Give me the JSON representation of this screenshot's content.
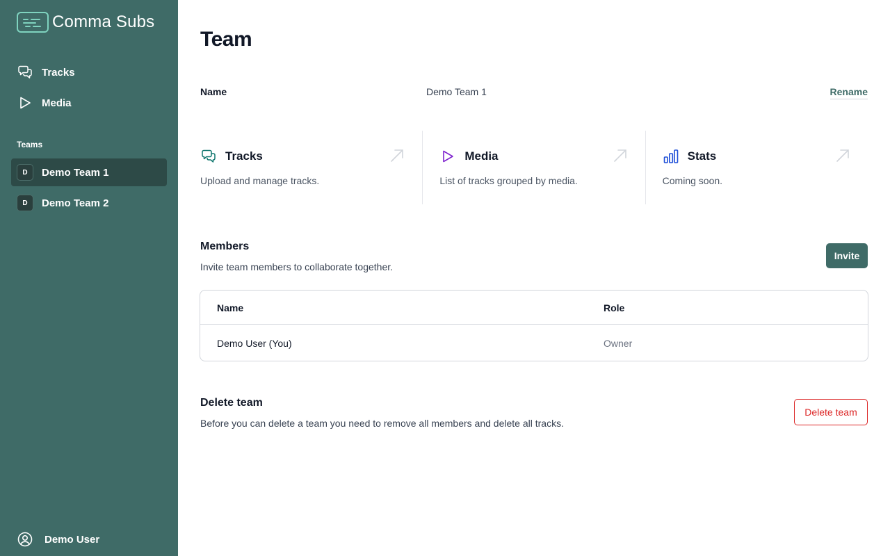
{
  "app": {
    "name": "Comma Subs"
  },
  "sidebar": {
    "nav": [
      {
        "label": "Tracks",
        "icon": "chat-bubbles-icon"
      },
      {
        "label": "Media",
        "icon": "play-icon"
      }
    ],
    "teams_heading": "Teams",
    "teams": [
      {
        "initial": "D",
        "label": "Demo Team 1",
        "active": true
      },
      {
        "initial": "D",
        "label": "Demo Team 2",
        "active": false
      }
    ],
    "user": {
      "label": "Demo User",
      "icon": "user-circle-icon"
    }
  },
  "page": {
    "title": "Team",
    "name_label": "Name",
    "name_value": "Demo Team 1",
    "rename_label": "Rename"
  },
  "cards": [
    {
      "title": "Tracks",
      "description": "Upload and manage tracks.",
      "icon": "chat-bubbles-icon",
      "color": "#0f766e"
    },
    {
      "title": "Media",
      "description": "List of tracks grouped by media.",
      "icon": "play-icon",
      "color": "#7e22ce"
    },
    {
      "title": "Stats",
      "description": "Coming soon.",
      "icon": "bar-chart-icon",
      "color": "#1d4ed8"
    }
  ],
  "members": {
    "title": "Members",
    "description": "Invite team members to collaborate together.",
    "invite_label": "Invite",
    "columns": [
      "Name",
      "Role"
    ],
    "rows": [
      {
        "name": "Demo User (You)",
        "role": "Owner"
      }
    ]
  },
  "delete_team": {
    "title": "Delete team",
    "description": "Before you can delete a team you need to remove all members and delete all tracks.",
    "button_label": "Delete team"
  },
  "colors": {
    "sidebar_bg": "#3f6b67",
    "active_team_bg": "#2d4a47",
    "accent": "#3f6b67",
    "danger": "#dc2626"
  }
}
